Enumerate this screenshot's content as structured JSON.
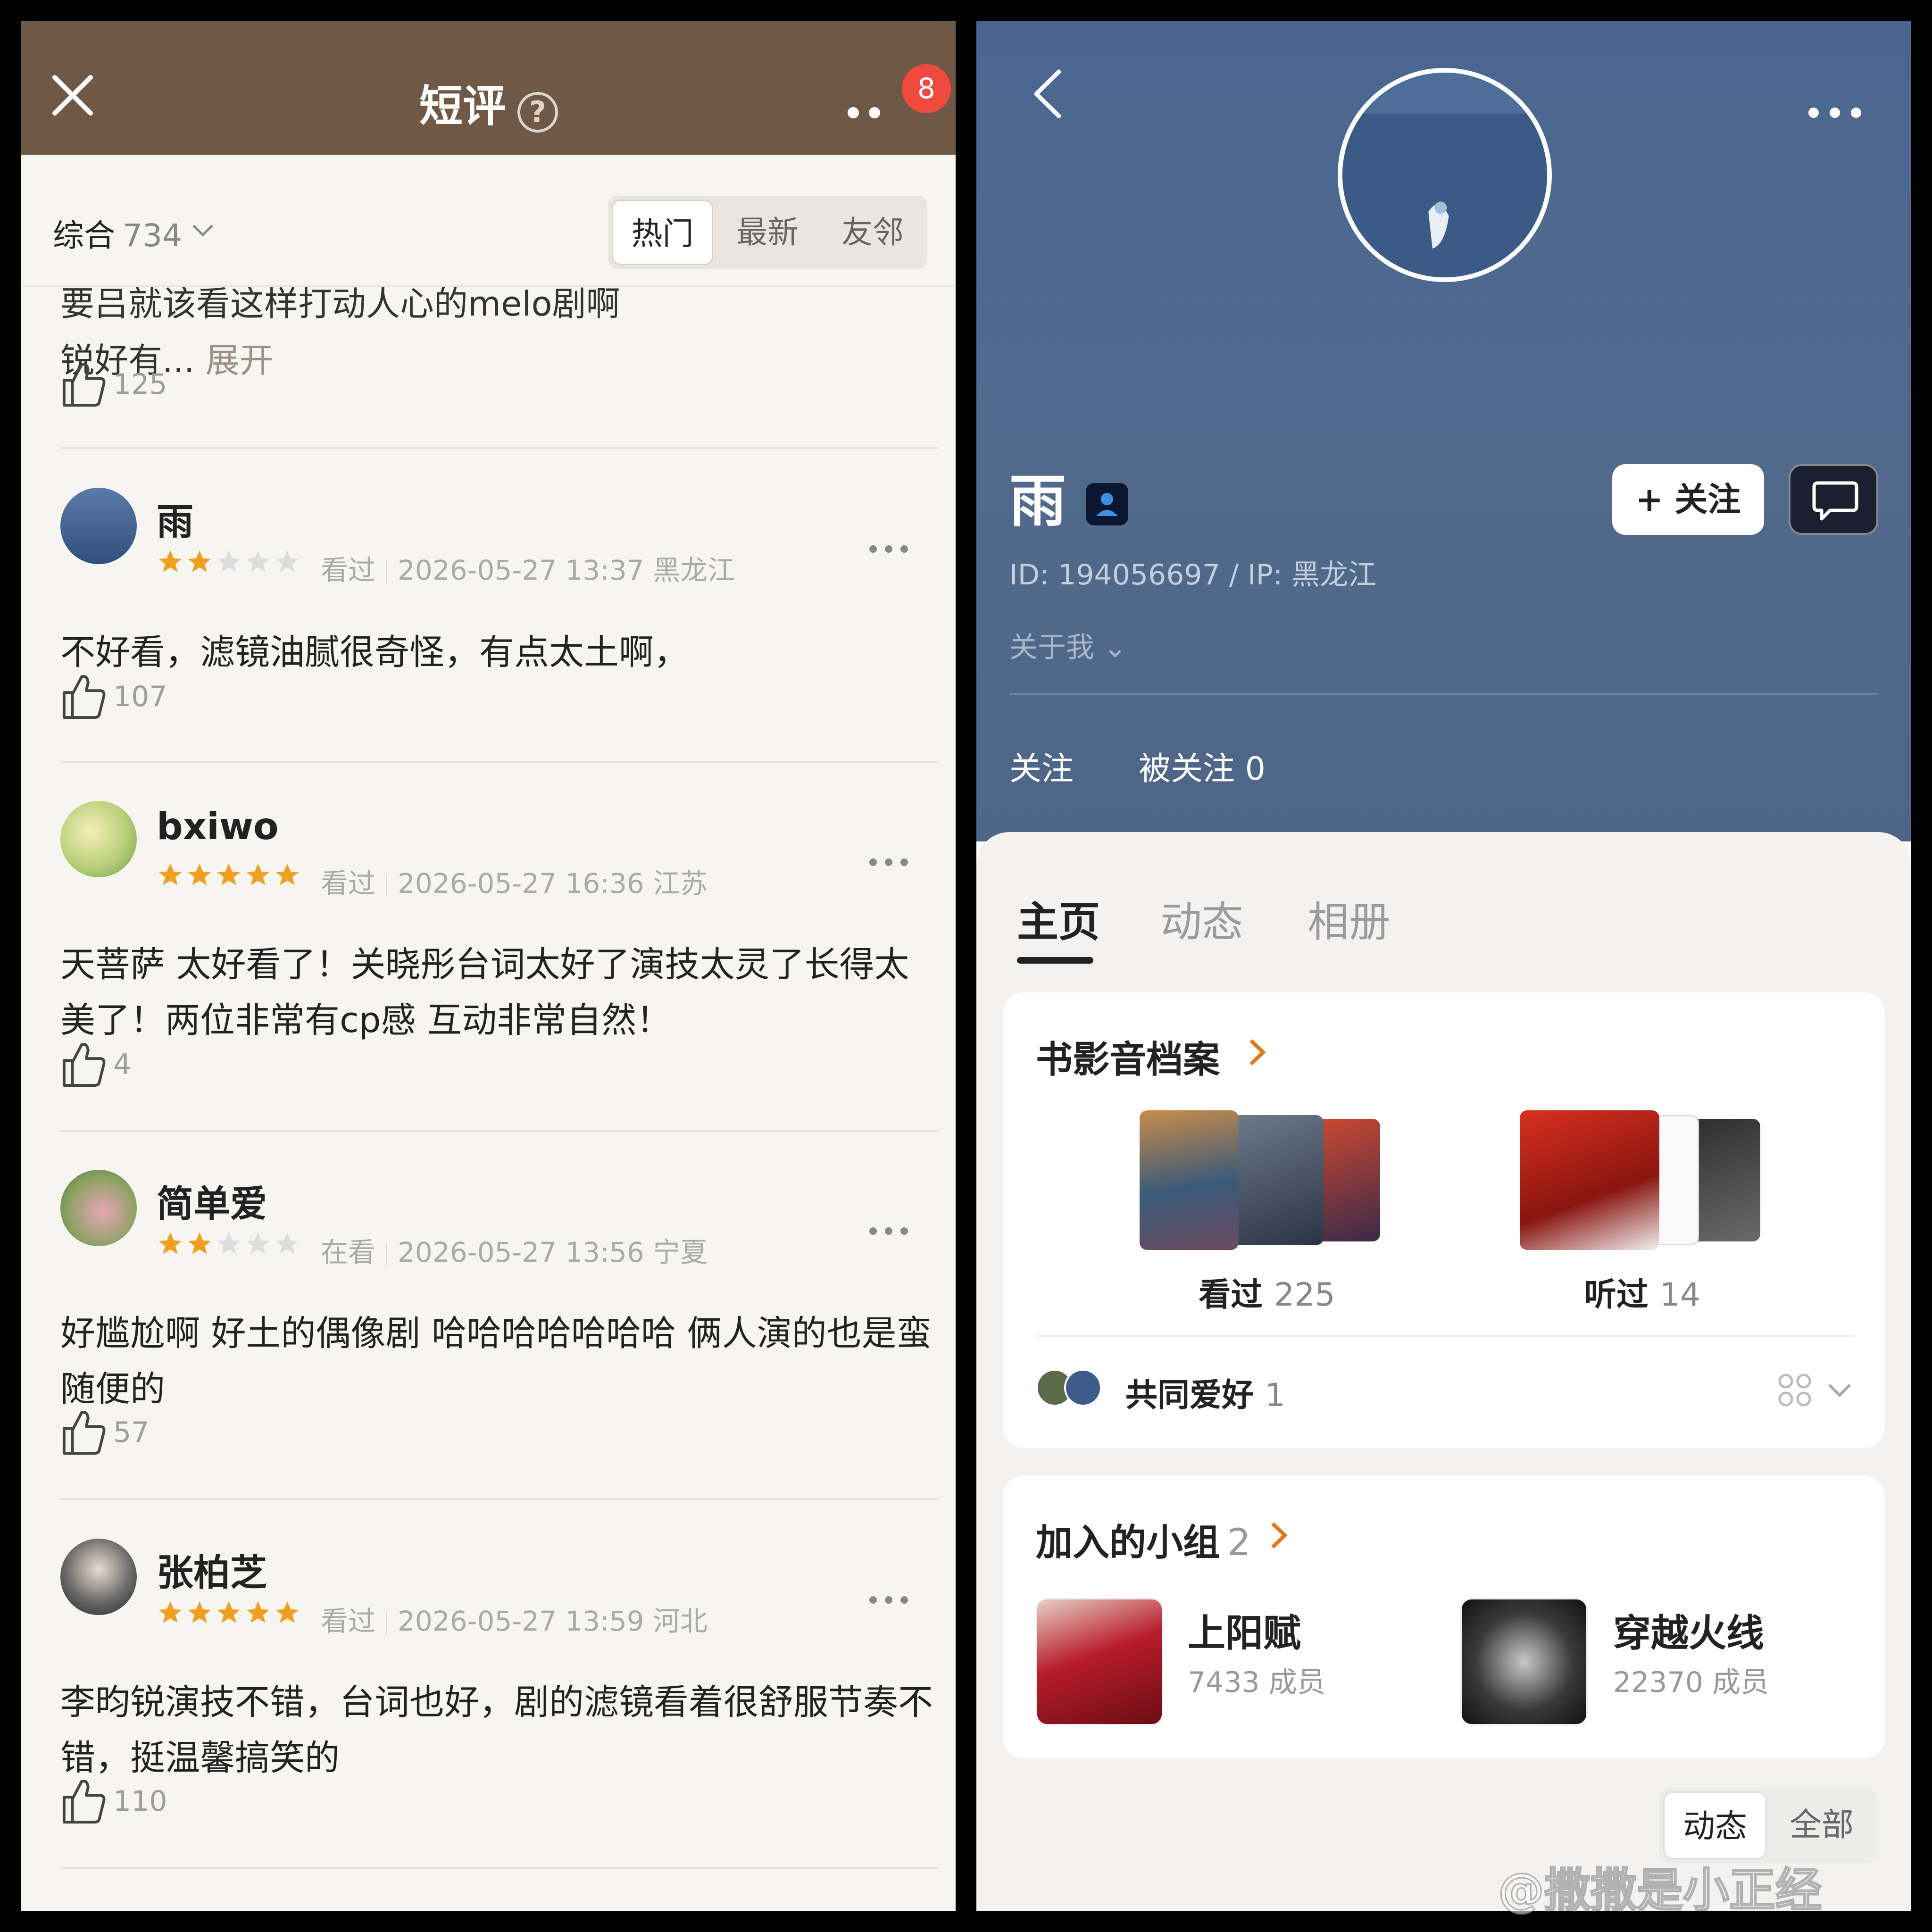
{
  "left": {
    "title": "短评",
    "help_symbol": "?",
    "badge": "8",
    "sort": {
      "label": "综合",
      "count": "734"
    },
    "segments": [
      "热门",
      "最新",
      "友邻"
    ],
    "fragment": {
      "line1": "要吕就该看这样打动人心的melo剧啊",
      "line2": "锐好有...",
      "expand": "展开",
      "likes": "125"
    },
    "reviews": [
      {
        "user": "雨",
        "stars": 2,
        "status": "看过",
        "time": "2026-05-27 13:37",
        "region": "黑龙江",
        "text": "不好看，滤镜油腻很奇怪，有点太土啊，",
        "likes": "107"
      },
      {
        "user": "bxiwo",
        "stars": 5,
        "status": "看过",
        "time": "2026-05-27 16:36",
        "region": "江苏",
        "text": "天菩萨 太好看了！关晓彤台词太好了演技太灵了长得太美了！两位非常有cp感 互动非常自然！",
        "likes": "4"
      },
      {
        "user": "简单爱",
        "stars": 2,
        "status": "在看",
        "time": "2026-05-27 13:56",
        "region": "宁夏",
        "text": "好尴尬啊  好土的偶像剧  哈哈哈哈哈哈哈 俩人演的也是蛮随便的",
        "likes": "57"
      },
      {
        "user": "张柏芝",
        "stars": 5,
        "status": "看过",
        "time": "2026-05-27 13:59",
        "region": "河北",
        "text": "李昀锐演技不错，台词也好，剧的滤镜看着很舒服节奏不错，挺温馨搞笑的",
        "likes": "110"
      }
    ]
  },
  "right": {
    "name": "雨",
    "id_line": "ID: 194056697 / IP: 黑龙江",
    "follow_button": "+ 关注",
    "about": "关于我",
    "following_label": "关注",
    "followers_label": "被关注 0",
    "tabs": [
      "主页",
      "动态",
      "相册"
    ],
    "archive": {
      "title": "书影音档案",
      "watched_label": "看过",
      "watched_count": "225",
      "listened_label": "听过",
      "listened_count": "14"
    },
    "shared": {
      "label": "共同爱好",
      "count": "1"
    },
    "groups": {
      "title": "加入的小组",
      "count": "2",
      "items": [
        {
          "name": "上阳赋",
          "members": "7433 成员"
        },
        {
          "name": "穿越火线",
          "members": "22370 成员"
        }
      ]
    },
    "bottom_segments": [
      "动态",
      "全部"
    ]
  },
  "watermark": "@撒撒是小正经",
  "colors": {
    "left_header": "#6f5846",
    "star": "#f0a020",
    "hero": "#4e6890"
  }
}
